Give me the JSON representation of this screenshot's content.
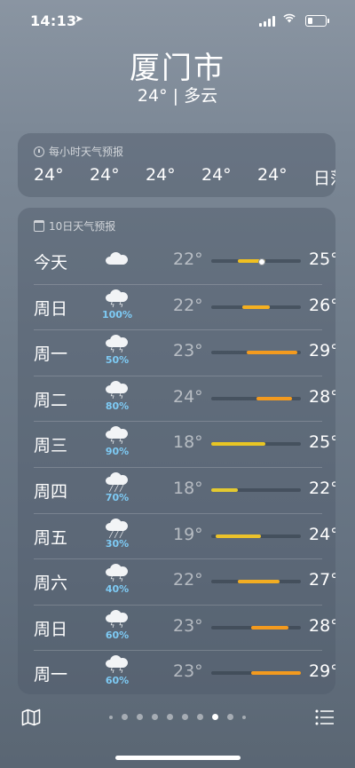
{
  "status_bar": {
    "time": "14:13",
    "location_icon": "location-arrow-icon",
    "signal_icon": "cellular-signal-icon",
    "wifi_icon": "wifi-icon",
    "battery_icon": "battery-icon",
    "battery_level": 0.25
  },
  "header": {
    "city": "厦门市",
    "summary": "24° | 多云"
  },
  "hourly": {
    "title": "每小时天气预报",
    "icon": "clock-icon",
    "temps": [
      "24°",
      "24°",
      "24°",
      "24°",
      "24°"
    ],
    "trailing_label": "日落"
  },
  "daily": {
    "title": "10日天气预报",
    "icon": "calendar-icon",
    "days": [
      {
        "name": "今天",
        "icon": "cloud-icon",
        "precip": "",
        "low": "22°",
        "high": "25°",
        "bar_start": 0.3,
        "bar_end": 0.6,
        "bar_color": "#f0c020",
        "current": 0.55
      },
      {
        "name": "周日",
        "icon": "thunderstorm-icon",
        "precip": "100%",
        "low": "22°",
        "high": "26°",
        "bar_start": 0.35,
        "bar_end": 0.65,
        "bar_color": "#f5b020"
      },
      {
        "name": "周一",
        "icon": "thunderstorm-icon",
        "precip": "50%",
        "low": "23°",
        "high": "29°",
        "bar_start": 0.4,
        "bar_end": 0.96,
        "bar_color": "#f39a1e"
      },
      {
        "name": "周二",
        "icon": "thunderstorm-icon",
        "precip": "80%",
        "low": "24°",
        "high": "28°",
        "bar_start": 0.5,
        "bar_end": 0.9,
        "bar_color": "#f39a1e"
      },
      {
        "name": "周三",
        "icon": "thunderstorm-icon",
        "precip": "90%",
        "low": "18°",
        "high": "25°",
        "bar_start": 0.0,
        "bar_end": 0.6,
        "bar_color": "#e9c623"
      },
      {
        "name": "周四",
        "icon": "rain-icon",
        "precip": "70%",
        "low": "18°",
        "high": "22°",
        "bar_start": 0.0,
        "bar_end": 0.3,
        "bar_color": "#e3c930"
      },
      {
        "name": "周五",
        "icon": "rain-icon",
        "precip": "30%",
        "low": "19°",
        "high": "24°",
        "bar_start": 0.05,
        "bar_end": 0.55,
        "bar_color": "#ecc22a"
      },
      {
        "name": "周六",
        "icon": "thunderstorm-icon",
        "precip": "40%",
        "low": "22°",
        "high": "27°",
        "bar_start": 0.3,
        "bar_end": 0.76,
        "bar_color": "#f2ad22"
      },
      {
        "name": "周日",
        "icon": "thunderstorm-icon",
        "precip": "60%",
        "low": "23°",
        "high": "28°",
        "bar_start": 0.45,
        "bar_end": 0.86,
        "bar_color": "#f39a1e"
      },
      {
        "name": "周一",
        "icon": "thunderstorm-icon",
        "precip": "60%",
        "low": "23°",
        "high": "29°",
        "bar_start": 0.45,
        "bar_end": 1.0,
        "bar_color": "#f39a1e"
      }
    ]
  },
  "bottom_bar": {
    "map_icon": "map-icon",
    "list_icon": "list-icon",
    "page_count": 10,
    "active_page": 8
  }
}
